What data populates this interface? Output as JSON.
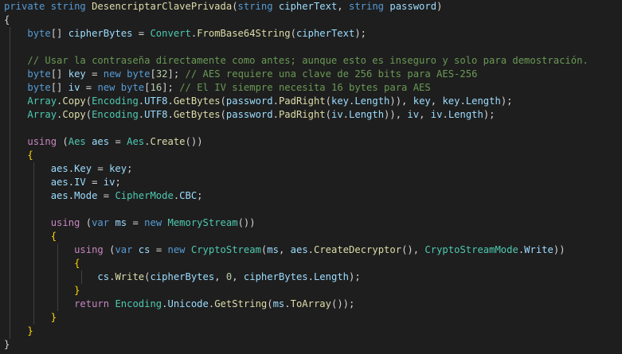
{
  "editor": {
    "language": "csharp",
    "colors": {
      "background": "#1e1e1e",
      "keyword": "#569cd6",
      "control": "#c586c0",
      "type": "#4ec9b0",
      "method": "#dcdcaa",
      "variable": "#9cdcfe",
      "number": "#b5cea8",
      "comment": "#6a9955",
      "punct": "#d4d4d4",
      "brace": "#ffd700"
    },
    "lines": [
      [
        [
          "keyword",
          "private"
        ],
        [
          "punct",
          " "
        ],
        [
          "keyword",
          "string"
        ],
        [
          "punct",
          " "
        ],
        [
          "method",
          "DesencriptarClavePrivada"
        ],
        [
          "punct",
          "("
        ],
        [
          "keyword",
          "string"
        ],
        [
          "punct",
          " "
        ],
        [
          "variable",
          "cipherText"
        ],
        [
          "punct",
          ", "
        ],
        [
          "keyword",
          "string"
        ],
        [
          "punct",
          " "
        ],
        [
          "variable",
          "password"
        ],
        [
          "punct",
          ")"
        ]
      ],
      [
        [
          "punct",
          "{"
        ]
      ],
      [
        [
          "punct",
          "    "
        ],
        [
          "keyword",
          "byte"
        ],
        [
          "punct",
          "[] "
        ],
        [
          "variable",
          "cipherBytes"
        ],
        [
          "punct",
          " = "
        ],
        [
          "type",
          "Convert"
        ],
        [
          "punct",
          "."
        ],
        [
          "method",
          "FromBase64String"
        ],
        [
          "punct",
          "("
        ],
        [
          "variable",
          "cipherText"
        ],
        [
          "punct",
          ");"
        ]
      ],
      [],
      [
        [
          "punct",
          "    "
        ],
        [
          "comment",
          "// Usar la contraseña directamente como antes; aunque esto es inseguro y solo para demostración."
        ]
      ],
      [
        [
          "punct",
          "    "
        ],
        [
          "keyword",
          "byte"
        ],
        [
          "punct",
          "[] "
        ],
        [
          "variable",
          "key"
        ],
        [
          "punct",
          " = "
        ],
        [
          "keyword",
          "new"
        ],
        [
          "punct",
          " "
        ],
        [
          "keyword",
          "byte"
        ],
        [
          "punct",
          "["
        ],
        [
          "number",
          "32"
        ],
        [
          "punct",
          "]; "
        ],
        [
          "comment",
          "// AES requiere una clave de 256 bits para AES-256"
        ]
      ],
      [
        [
          "punct",
          "    "
        ],
        [
          "keyword",
          "byte"
        ],
        [
          "punct",
          "[] "
        ],
        [
          "variable",
          "iv"
        ],
        [
          "punct",
          " = "
        ],
        [
          "keyword",
          "new"
        ],
        [
          "punct",
          " "
        ],
        [
          "keyword",
          "byte"
        ],
        [
          "punct",
          "["
        ],
        [
          "number",
          "16"
        ],
        [
          "punct",
          "]; "
        ],
        [
          "comment",
          "// El IV siempre necesita 16 bytes para AES"
        ]
      ],
      [
        [
          "punct",
          "    "
        ],
        [
          "type",
          "Array"
        ],
        [
          "punct",
          "."
        ],
        [
          "method",
          "Copy"
        ],
        [
          "punct",
          "("
        ],
        [
          "type",
          "Encoding"
        ],
        [
          "punct",
          "."
        ],
        [
          "variable",
          "UTF8"
        ],
        [
          "punct",
          "."
        ],
        [
          "method",
          "GetBytes"
        ],
        [
          "punct",
          "("
        ],
        [
          "variable",
          "password"
        ],
        [
          "punct",
          "."
        ],
        [
          "method",
          "PadRight"
        ],
        [
          "punct",
          "("
        ],
        [
          "variable",
          "key"
        ],
        [
          "punct",
          "."
        ],
        [
          "variable",
          "Length"
        ],
        [
          "punct",
          ")), "
        ],
        [
          "variable",
          "key"
        ],
        [
          "punct",
          ", "
        ],
        [
          "variable",
          "key"
        ],
        [
          "punct",
          "."
        ],
        [
          "variable",
          "Length"
        ],
        [
          "punct",
          ");"
        ]
      ],
      [
        [
          "punct",
          "    "
        ],
        [
          "type",
          "Array"
        ],
        [
          "punct",
          "."
        ],
        [
          "method",
          "Copy"
        ],
        [
          "punct",
          "("
        ],
        [
          "type",
          "Encoding"
        ],
        [
          "punct",
          "."
        ],
        [
          "variable",
          "UTF8"
        ],
        [
          "punct",
          "."
        ],
        [
          "method",
          "GetBytes"
        ],
        [
          "punct",
          "("
        ],
        [
          "variable",
          "password"
        ],
        [
          "punct",
          "."
        ],
        [
          "method",
          "PadRight"
        ],
        [
          "punct",
          "("
        ],
        [
          "variable",
          "iv"
        ],
        [
          "punct",
          "."
        ],
        [
          "variable",
          "Length"
        ],
        [
          "punct",
          ")), "
        ],
        [
          "variable",
          "iv"
        ],
        [
          "punct",
          ", "
        ],
        [
          "variable",
          "iv"
        ],
        [
          "punct",
          "."
        ],
        [
          "variable",
          "Length"
        ],
        [
          "punct",
          ");"
        ]
      ],
      [],
      [
        [
          "punct",
          "    "
        ],
        [
          "control",
          "using"
        ],
        [
          "punct",
          " ("
        ],
        [
          "type",
          "Aes"
        ],
        [
          "punct",
          " "
        ],
        [
          "variable",
          "aes"
        ],
        [
          "punct",
          " = "
        ],
        [
          "type",
          "Aes"
        ],
        [
          "punct",
          "."
        ],
        [
          "method",
          "Create"
        ],
        [
          "punct",
          "())"
        ]
      ],
      [
        [
          "punct",
          "    "
        ],
        [
          "brace",
          "{"
        ]
      ],
      [
        [
          "punct",
          "        "
        ],
        [
          "variable",
          "aes"
        ],
        [
          "punct",
          "."
        ],
        [
          "variable",
          "Key"
        ],
        [
          "punct",
          " = "
        ],
        [
          "variable",
          "key"
        ],
        [
          "punct",
          ";"
        ]
      ],
      [
        [
          "punct",
          "        "
        ],
        [
          "variable",
          "aes"
        ],
        [
          "punct",
          "."
        ],
        [
          "variable",
          "IV"
        ],
        [
          "punct",
          " = "
        ],
        [
          "variable",
          "iv"
        ],
        [
          "punct",
          ";"
        ]
      ],
      [
        [
          "punct",
          "        "
        ],
        [
          "variable",
          "aes"
        ],
        [
          "punct",
          "."
        ],
        [
          "variable",
          "Mode"
        ],
        [
          "punct",
          " = "
        ],
        [
          "type",
          "CipherMode"
        ],
        [
          "punct",
          "."
        ],
        [
          "variable",
          "CBC"
        ],
        [
          "punct",
          ";"
        ]
      ],
      [],
      [
        [
          "punct",
          "        "
        ],
        [
          "control",
          "using"
        ],
        [
          "punct",
          " ("
        ],
        [
          "keyword",
          "var"
        ],
        [
          "punct",
          " "
        ],
        [
          "variable",
          "ms"
        ],
        [
          "punct",
          " = "
        ],
        [
          "keyword",
          "new"
        ],
        [
          "punct",
          " "
        ],
        [
          "type",
          "MemoryStream"
        ],
        [
          "punct",
          "())"
        ]
      ],
      [
        [
          "punct",
          "        "
        ],
        [
          "brace",
          "{"
        ]
      ],
      [
        [
          "punct",
          "            "
        ],
        [
          "control",
          "using"
        ],
        [
          "punct",
          " ("
        ],
        [
          "keyword",
          "var"
        ],
        [
          "punct",
          " "
        ],
        [
          "variable",
          "cs"
        ],
        [
          "punct",
          " = "
        ],
        [
          "keyword",
          "new"
        ],
        [
          "punct",
          " "
        ],
        [
          "type",
          "CryptoStream"
        ],
        [
          "punct",
          "("
        ],
        [
          "variable",
          "ms"
        ],
        [
          "punct",
          ", "
        ],
        [
          "variable",
          "aes"
        ],
        [
          "punct",
          "."
        ],
        [
          "method",
          "CreateDecryptor"
        ],
        [
          "punct",
          "(), "
        ],
        [
          "type",
          "CryptoStreamMode"
        ],
        [
          "punct",
          "."
        ],
        [
          "variable",
          "Write"
        ],
        [
          "punct",
          "))"
        ]
      ],
      [
        [
          "punct",
          "            "
        ],
        [
          "brace",
          "{"
        ]
      ],
      [
        [
          "punct",
          "                "
        ],
        [
          "variable",
          "cs"
        ],
        [
          "punct",
          "."
        ],
        [
          "method",
          "Write"
        ],
        [
          "punct",
          "("
        ],
        [
          "variable",
          "cipherBytes"
        ],
        [
          "punct",
          ", "
        ],
        [
          "number",
          "0"
        ],
        [
          "punct",
          ", "
        ],
        [
          "variable",
          "cipherBytes"
        ],
        [
          "punct",
          "."
        ],
        [
          "variable",
          "Length"
        ],
        [
          "punct",
          ");"
        ]
      ],
      [
        [
          "punct",
          "            "
        ],
        [
          "brace",
          "}"
        ]
      ],
      [
        [
          "punct",
          "            "
        ],
        [
          "control",
          "return"
        ],
        [
          "punct",
          " "
        ],
        [
          "type",
          "Encoding"
        ],
        [
          "punct",
          "."
        ],
        [
          "variable",
          "Unicode"
        ],
        [
          "punct",
          "."
        ],
        [
          "method",
          "GetString"
        ],
        [
          "punct",
          "("
        ],
        [
          "variable",
          "ms"
        ],
        [
          "punct",
          "."
        ],
        [
          "method",
          "ToArray"
        ],
        [
          "punct",
          "());"
        ]
      ],
      [
        [
          "punct",
          "        "
        ],
        [
          "brace",
          "}"
        ]
      ],
      [
        [
          "punct",
          "    "
        ],
        [
          "brace",
          "}"
        ]
      ],
      [
        [
          "punct",
          "}"
        ]
      ]
    ]
  }
}
